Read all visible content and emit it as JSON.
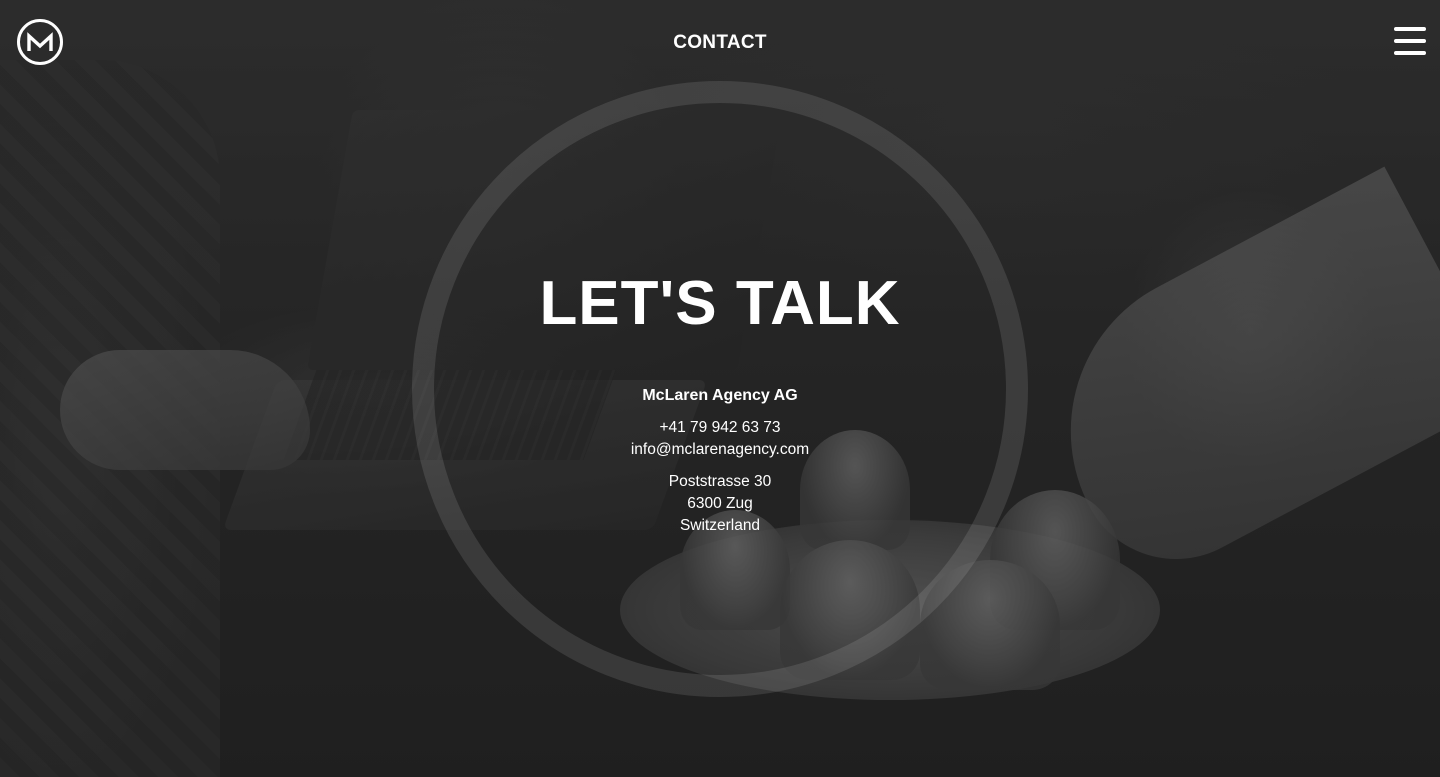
{
  "header": {
    "logo_icon": "m-logo-icon",
    "title": "CONTACT",
    "menu_icon": "hamburger-menu-icon"
  },
  "hero": {
    "headline": "LET'S TALK"
  },
  "contact": {
    "company": "McLaren Agency AG",
    "phone": "+41 79 942 63 73",
    "email": "info@mclarenagency.com",
    "address": {
      "street": "Poststrasse 30",
      "city": "6300 Zug",
      "country": "Switzerland"
    }
  },
  "colors": {
    "text": "#ffffff",
    "ring": "rgba(255,255,255,0.11)"
  }
}
